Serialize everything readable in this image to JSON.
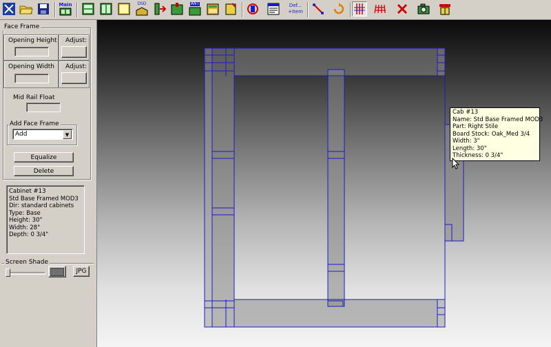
{
  "toolbar": {
    "buttons": [
      {
        "name": "tools-icon"
      },
      {
        "name": "open-folder-icon"
      },
      {
        "name": "save-icon"
      },
      {
        "name": "main-icon",
        "label": "Main"
      },
      {
        "name": "cabinet-icon-1"
      },
      {
        "name": "cabinet-icon-2"
      },
      {
        "name": "cabinet-icon-3"
      },
      {
        "name": "cabinet-dsd-icon",
        "label": "DSD"
      },
      {
        "name": "cabinet-icon-5"
      },
      {
        "name": "cabinet-icon-6"
      },
      {
        "name": "cabinet-ant-icon",
        "label": "ANT"
      },
      {
        "name": "cabinet-icon-8"
      },
      {
        "name": "cabinet-icon-9"
      },
      {
        "name": "cabinet-icon-10"
      },
      {
        "name": "report-icon"
      },
      {
        "name": "def-item-icon",
        "label_top": "Def...",
        "label_bottom": "+Item"
      },
      {
        "name": "arrow-tool-icon"
      },
      {
        "name": "rotate-icon"
      },
      {
        "name": "grid-view-icon"
      },
      {
        "name": "perspective-grid-icon"
      },
      {
        "name": "delete-x-icon"
      },
      {
        "name": "camera-icon"
      },
      {
        "name": "measure-icon"
      }
    ]
  },
  "face_frame": {
    "title": "Face Frame",
    "opening_height_label": "Opening Height",
    "adjust_label_1": "Adjust:",
    "opening_width_label": "Opening Width",
    "adjust_label_2": "Adjust:",
    "mid_rail_float_label": "Mid Rail Float",
    "add_face_frame_title": "Add Face Frame",
    "add_select_value": "Add",
    "equalize_button": "Equalize",
    "delete_button": "Delete"
  },
  "cabinet_info": {
    "lines": [
      "Cabinet #13",
      "Std Base Framed MOD3",
      "Dir: standard cabinets",
      "Type: Base",
      "Height: 30\"",
      "Width: 28\"",
      "Depth: 0 3/4\""
    ]
  },
  "screen_shade": {
    "label": "Screen Shade",
    "jpg_button": "JPG"
  },
  "tooltip": {
    "lines": [
      "Cab #13",
      "Name: Std Base Framed MOD3",
      "Part: Right Stile",
      "Board Stock: Oak_Med 3/4",
      "Width: 3\"",
      "Length: 30\"",
      "Thickness: 0 3/4\""
    ]
  },
  "colors": {
    "outline": "#1a1ac8",
    "part_fill": "#8a8a8a"
  }
}
